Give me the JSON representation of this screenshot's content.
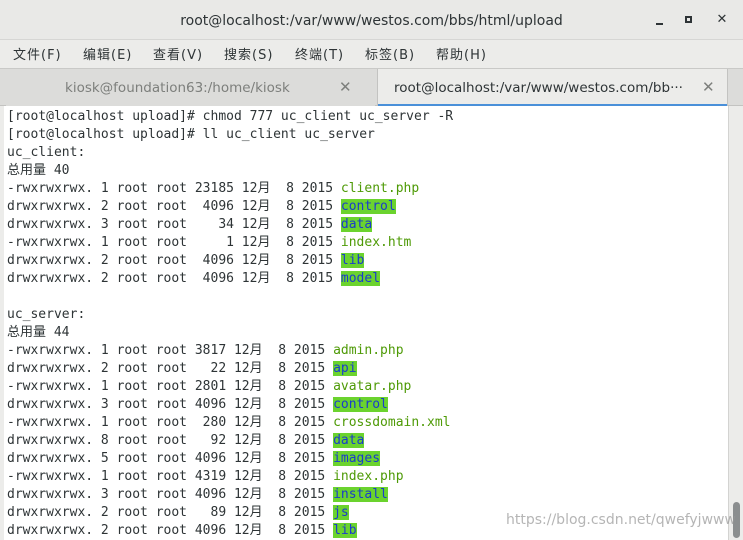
{
  "window": {
    "title": "root@localhost:/var/www/westos.com/bbs/html/upload"
  },
  "menu": [
    "文件(F)",
    "编辑(E)",
    "查看(V)",
    "搜索(S)",
    "终端(T)",
    "标签(B)",
    "帮助(H)"
  ],
  "tabs": [
    {
      "label": "kiosk@foundation63:/home/kiosk",
      "active": false
    },
    {
      "label": "root@localhost:/var/www/westos.com/bb···",
      "active": true
    }
  ],
  "terminal": {
    "lines": [
      [
        {
          "t": "[root@localhost upload]# chmod 777 uc_client uc_server -R",
          "c": ""
        }
      ],
      [
        {
          "t": "[root@localhost upload]# ll uc_client uc_server",
          "c": ""
        }
      ],
      [
        {
          "t": "uc_client:",
          "c": ""
        }
      ],
      [
        {
          "t": "总用量 40",
          "c": ""
        }
      ],
      [
        {
          "t": "-rwxrwxrwx. 1 root root 23185 12月  8 2015 ",
          "c": ""
        },
        {
          "t": "client.php",
          "c": "green"
        }
      ],
      [
        {
          "t": "drwxrwxrwx. 2 root root  4096 12月  8 2015 ",
          "c": ""
        },
        {
          "t": "control",
          "c": "hl"
        }
      ],
      [
        {
          "t": "drwxrwxrwx. 3 root root    34 12月  8 2015 ",
          "c": ""
        },
        {
          "t": "data",
          "c": "hl"
        }
      ],
      [
        {
          "t": "-rwxrwxrwx. 1 root root     1 12月  8 2015 ",
          "c": ""
        },
        {
          "t": "index.htm",
          "c": "green"
        }
      ],
      [
        {
          "t": "drwxrwxrwx. 2 root root  4096 12月  8 2015 ",
          "c": ""
        },
        {
          "t": "lib",
          "c": "hl"
        }
      ],
      [
        {
          "t": "drwxrwxrwx. 2 root root  4096 12月  8 2015 ",
          "c": ""
        },
        {
          "t": "model",
          "c": "hl"
        }
      ],
      [
        {
          "t": "",
          "c": ""
        }
      ],
      [
        {
          "t": "uc_server:",
          "c": ""
        }
      ],
      [
        {
          "t": "总用量 44",
          "c": ""
        }
      ],
      [
        {
          "t": "-rwxrwxrwx. 1 root root 3817 12月  8 2015 ",
          "c": ""
        },
        {
          "t": "admin.php",
          "c": "green"
        }
      ],
      [
        {
          "t": "drwxrwxrwx. 2 root root   22 12月  8 2015 ",
          "c": ""
        },
        {
          "t": "api",
          "c": "hl"
        }
      ],
      [
        {
          "t": "-rwxrwxrwx. 1 root root 2801 12月  8 2015 ",
          "c": ""
        },
        {
          "t": "avatar.php",
          "c": "green"
        }
      ],
      [
        {
          "t": "drwxrwxrwx. 3 root root 4096 12月  8 2015 ",
          "c": ""
        },
        {
          "t": "control",
          "c": "hl"
        }
      ],
      [
        {
          "t": "-rwxrwxrwx. 1 root root  280 12月  8 2015 ",
          "c": ""
        },
        {
          "t": "crossdomain.xml",
          "c": "green"
        }
      ],
      [
        {
          "t": "drwxrwxrwx. 8 root root   92 12月  8 2015 ",
          "c": ""
        },
        {
          "t": "data",
          "c": "hl"
        }
      ],
      [
        {
          "t": "drwxrwxrwx. 5 root root 4096 12月  8 2015 ",
          "c": ""
        },
        {
          "t": "images",
          "c": "hl"
        }
      ],
      [
        {
          "t": "-rwxrwxrwx. 1 root root 4319 12月  8 2015 ",
          "c": ""
        },
        {
          "t": "index.php",
          "c": "green"
        }
      ],
      [
        {
          "t": "drwxrwxrwx. 3 root root 4096 12月  8 2015 ",
          "c": ""
        },
        {
          "t": "install",
          "c": "hl"
        }
      ],
      [
        {
          "t": "drwxrwxrwx. 2 root root   89 12月  8 2015 ",
          "c": ""
        },
        {
          "t": "js",
          "c": "hl"
        }
      ],
      [
        {
          "t": "drwxrwxrwx. 2 root root 4096 12月  8 2015 ",
          "c": ""
        },
        {
          "t": "lib",
          "c": "hl"
        }
      ]
    ]
  },
  "watermark": "https://blog.csdn.net/qwefyjwww",
  "colors": {
    "executable_file": "#4e9a06",
    "dir_highlight_bg": "#6bd32e",
    "dir_highlight_fg": "#1a3ccc",
    "active_tab_accent": "#4a90d9"
  },
  "icons": {
    "minimize": "minimize-icon",
    "maximize": "maximize-icon",
    "close": "close-icon",
    "tab_close": "close-icon"
  }
}
